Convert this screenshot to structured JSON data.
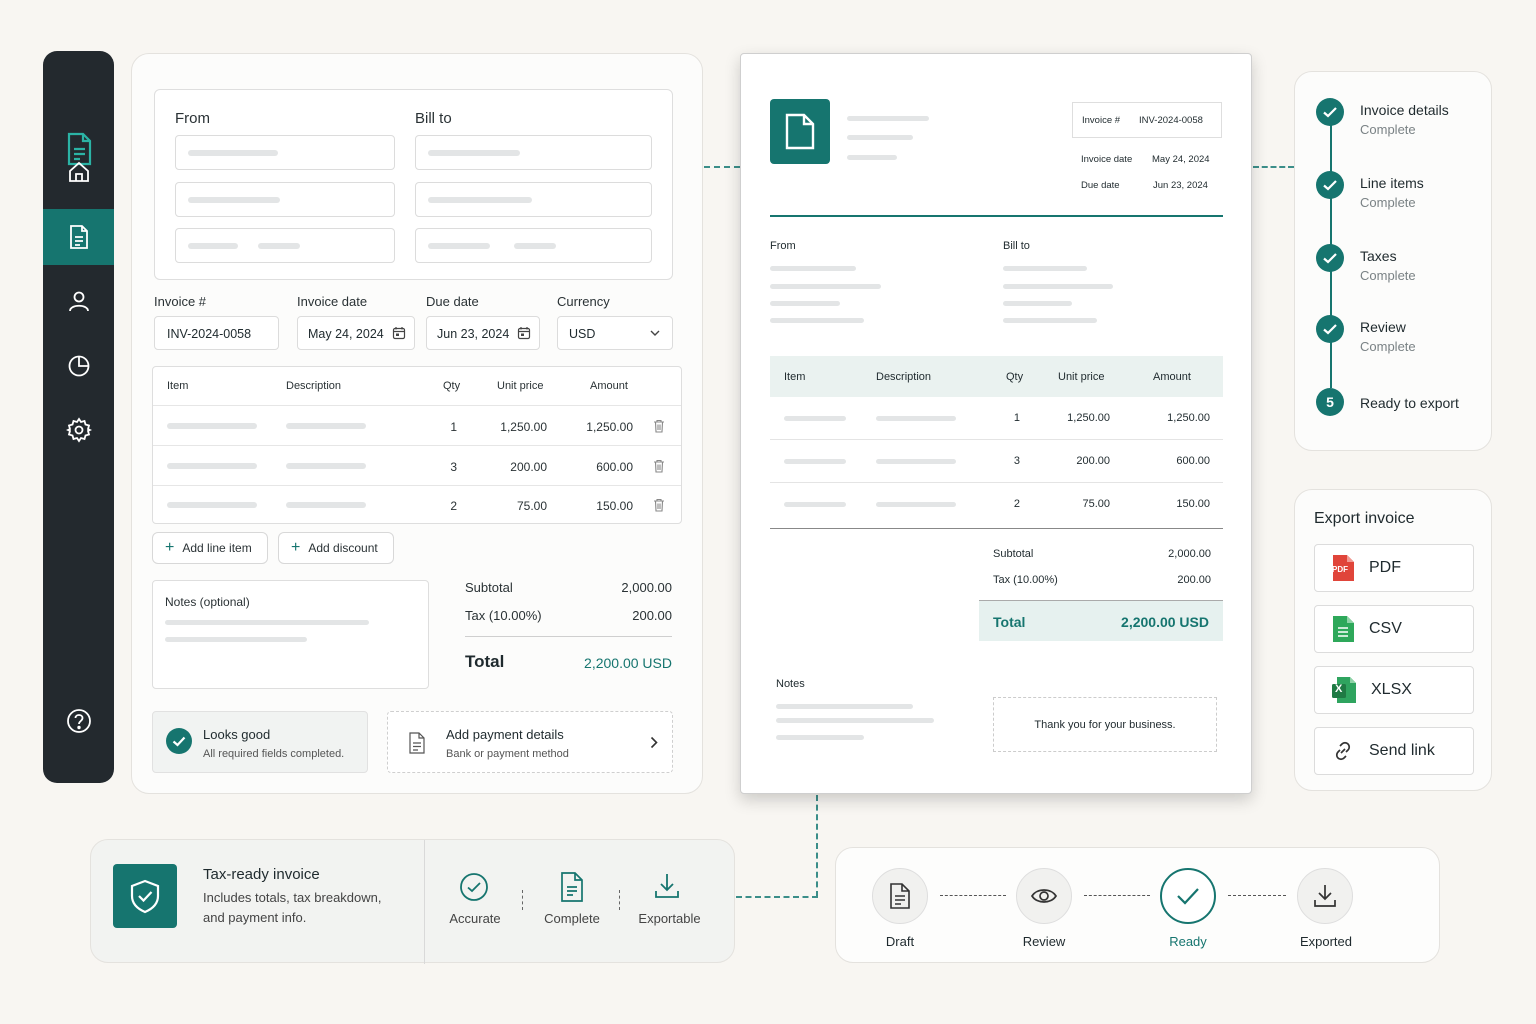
{
  "editor": {
    "from_label": "From",
    "billto_label": "Bill to",
    "invoice_no_label": "Invoice #",
    "invoice_no_value": "INV-2024-0058",
    "invoice_date_label": "Invoice date",
    "invoice_date_value": "May 24, 2024",
    "due_date_label": "Due date",
    "due_date_value": "Jun 23, 2024",
    "currency_label": "Currency",
    "currency_value": "USD",
    "table_headers": [
      "Item",
      "Description",
      "Qty",
      "Unit price",
      "Amount"
    ],
    "rows": [
      {
        "qty": "1",
        "unit": "1,250.00",
        "amount": "1,250.00"
      },
      {
        "qty": "3",
        "unit": "200.00",
        "amount": "600.00"
      },
      {
        "qty": "2",
        "unit": "75.00",
        "amount": "150.00"
      }
    ],
    "add_line_item": "Add line item",
    "add_discount": "Add discount",
    "notes_label": "Notes (optional)",
    "subtotal_label": "Subtotal",
    "subtotal_value": "2,000.00",
    "tax_label": "Tax (10.00%)",
    "tax_value": "200.00",
    "total_label": "Total",
    "total_value": "2,200.00 USD",
    "looks_good_title": "Looks good",
    "looks_good_sub": "All required fields completed.",
    "payment_title": "Add payment details",
    "payment_sub": "Bank or payment method"
  },
  "preview": {
    "invoice_no_label": "Invoice #",
    "invoice_no_value": "INV-2024-0058",
    "invoice_date_label": "Invoice date",
    "invoice_date_value": "May 24, 2024",
    "due_date_label": "Due date",
    "due_date_value": "Jun 23, 2024",
    "from_label": "From",
    "billto_label": "Bill to",
    "table_headers": [
      "Item",
      "Description",
      "Qty",
      "Unit price",
      "Amount"
    ],
    "rows": [
      {
        "qty": "1",
        "unit": "1,250.00",
        "amount": "1,250.00"
      },
      {
        "qty": "3",
        "unit": "200.00",
        "amount": "600.00"
      },
      {
        "qty": "2",
        "unit": "75.00",
        "amount": "150.00"
      }
    ],
    "subtotal_label": "Subtotal",
    "subtotal_value": "2,000.00",
    "tax_label": "Tax (10.00%)",
    "tax_value": "200.00",
    "total_label": "Total",
    "total_value": "2,200.00 USD",
    "notes_label": "Notes",
    "thanks": "Thank you for your business."
  },
  "steps": [
    {
      "title": "Invoice details",
      "status": "Complete"
    },
    {
      "title": "Line items",
      "status": "Complete"
    },
    {
      "title": "Taxes",
      "status": "Complete"
    },
    {
      "title": "Review",
      "status": "Complete"
    },
    {
      "title": "Ready to export",
      "number": "5"
    }
  ],
  "export": {
    "title": "Export invoice",
    "options": [
      "PDF",
      "CSV",
      "XLSX",
      "Send link"
    ],
    "pdf_badge": "PDF",
    "xlsx_badge": "X"
  },
  "taxready": {
    "title": "Tax-ready invoice",
    "desc_line1": "Includes totals, tax breakdown,",
    "desc_line2": "and payment info.",
    "features": [
      "Accurate",
      "Complete",
      "Exportable"
    ]
  },
  "status": {
    "stages": [
      "Draft",
      "Review",
      "Ready",
      "Exported"
    ],
    "current": "Ready"
  },
  "colors": {
    "accent": "#16756f",
    "sidebar": "#23292e",
    "pdf": "#e0453a",
    "csv": "#2ea85a",
    "xlsx": "#1f7a44"
  }
}
